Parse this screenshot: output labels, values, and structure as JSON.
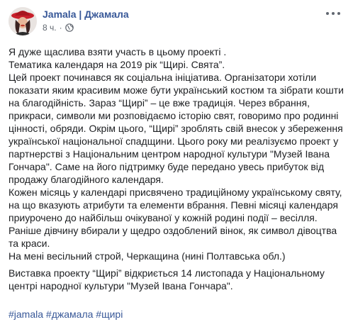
{
  "post": {
    "author": "Jamala | Джамала",
    "time": "8 ч.",
    "separator": "·",
    "privacy_icon": "globe-icon",
    "more_icon": "more-dots-icon",
    "link_color": "#385898",
    "lines": [
      "Я дуже щаслива взяти участь в цьому проекті .",
      "Тематика календаря на 2019 рік “Щирі. Свята”.",
      "Цей проект починався як соціальна ініціатива. Організатори хотіли",
      "показати яким красивим може бути український костюм та зібрати кошти",
      "на благодійність. Зараз “Щирі” – це вже традиція. Через вбрання,",
      "прикраси, символи ми розповідаємо історію свят, говоримо про родинні",
      "цінності, обряди. Окрім цього, “Щирі” зроблять свій внесок у збереження",
      "української національної спадщини. Цього року ми реалізуємо проект у",
      "партнерстві з Національним центром народної культури \"Музей Івана",
      "Гончара\". Саме на його підтримку буде передано увесь прибуток від",
      "продажу благодійного календаря.",
      "Кожен місяць у календарі присвячено традиційному українському святу,",
      "на що вказують атрибути та елементи вбрання. Певні місяці календаря",
      "приурочено до найбільш очікуваної у кожній родині події – весілля.",
      "Раніше дівчину вбирали у щедро оздоблений вінок, як символ дівоцтва",
      "та краси.",
      "На мені весільний строй, Черкащина (нині Полтавська обл.)"
    ],
    "paragraph2_lines": [
      "Виставка проекту “Щирі” відкриється 14 листопада у Національному",
      "центрі народної культури \"Музей Івана Гончара\"."
    ],
    "hashtags": [
      "#jamala",
      "#джамала",
      "#щирі"
    ]
  }
}
